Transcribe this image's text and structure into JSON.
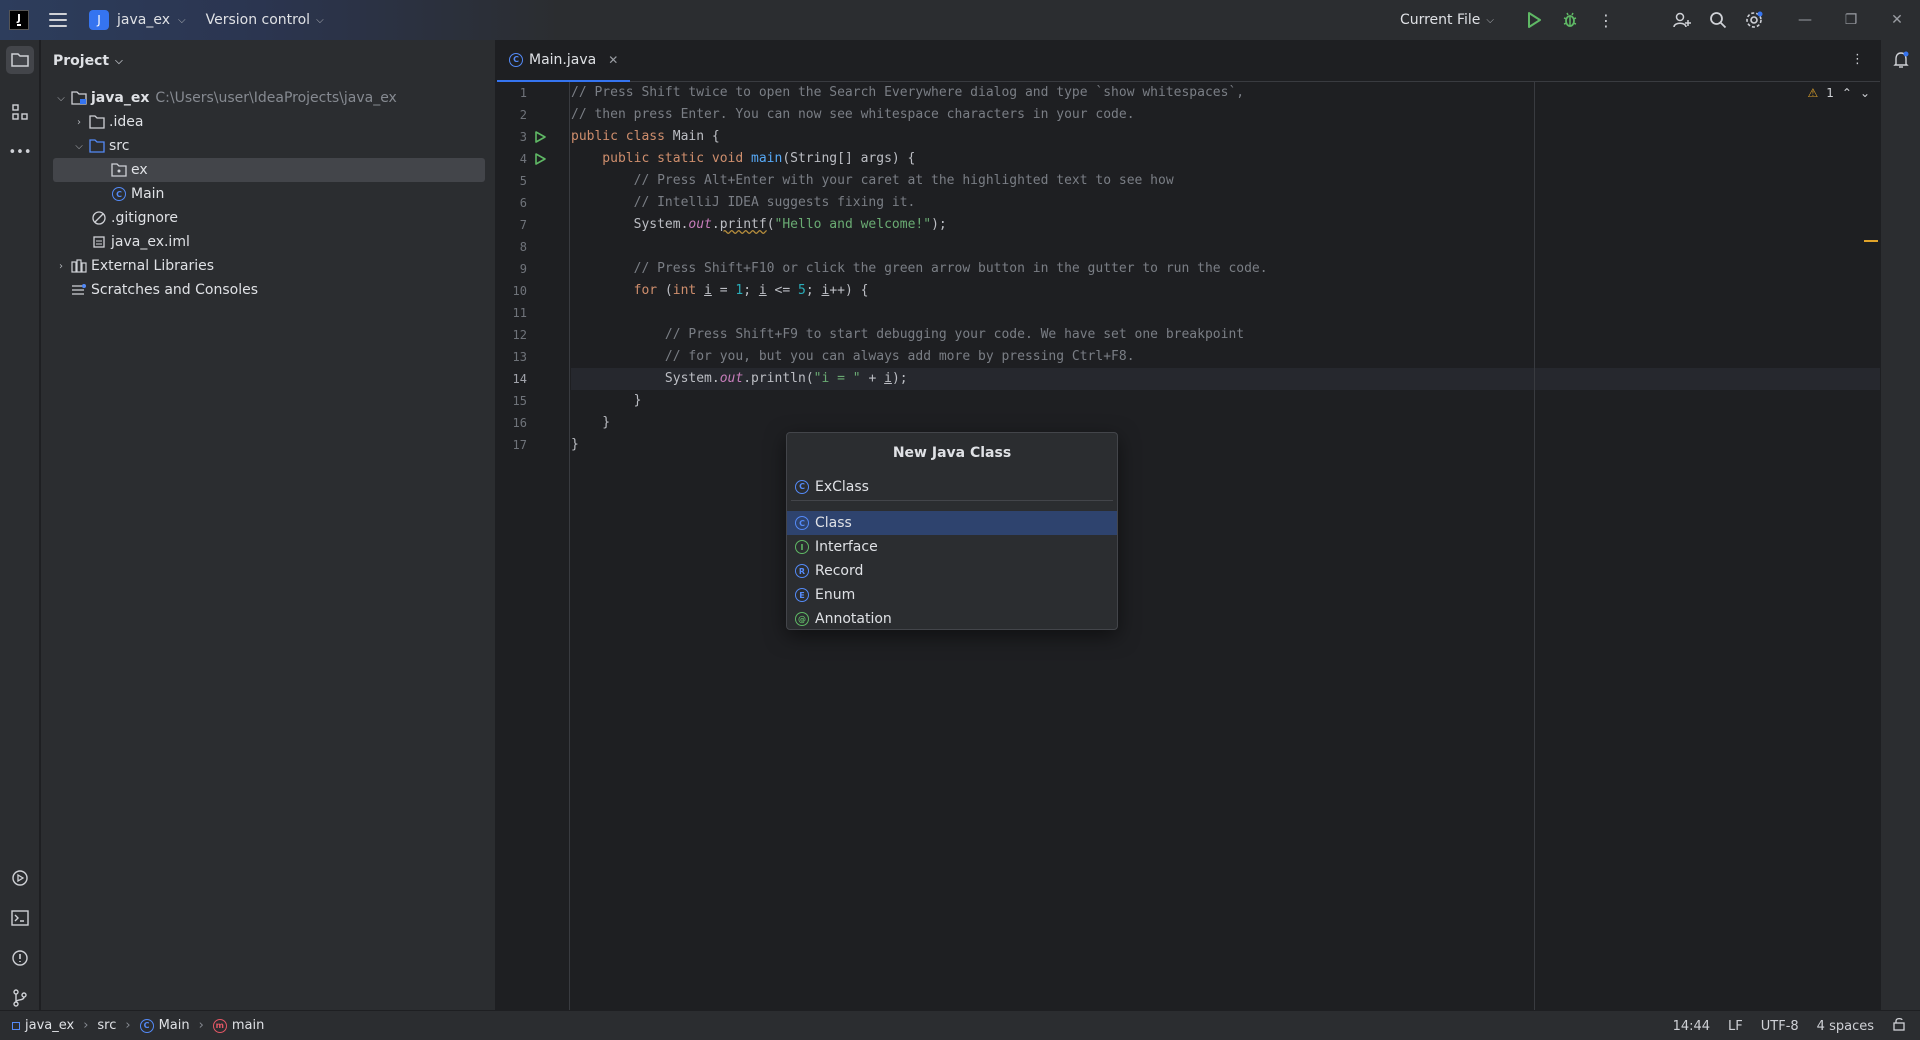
{
  "titlebar": {
    "project_badge": "J",
    "project_name": "java_ex",
    "vcs_label": "Version control",
    "run_config": "Current File"
  },
  "project_panel": {
    "title": "Project",
    "tree": [
      {
        "label": "java_ex",
        "path": "C:\\Users\\user\\IdeaProjects\\java_ex",
        "icon": "module-folder-icon",
        "expanded": true
      },
      {
        "label": ".idea",
        "icon": "folder-icon",
        "expanded": false
      },
      {
        "label": "src",
        "icon": "folder-icon",
        "expanded": true
      },
      {
        "label": "ex",
        "icon": "package-icon",
        "selected": true
      },
      {
        "label": "Main",
        "icon": "class-icon"
      },
      {
        "label": ".gitignore",
        "icon": "ignore-file-icon"
      },
      {
        "label": "java_ex.iml",
        "icon": "iml-file-icon"
      },
      {
        "label": "External Libraries",
        "icon": "libraries-icon",
        "expanded": false
      },
      {
        "label": "Scratches and Consoles",
        "icon": "scratches-icon"
      }
    ]
  },
  "editor": {
    "tab": "Main.java",
    "current_line": 14,
    "line_numbers": [
      "1",
      "2",
      "3",
      "4",
      "5",
      "6",
      "7",
      "8",
      "9",
      "10",
      "11",
      "12",
      "13",
      "14",
      "15",
      "16",
      "17"
    ],
    "warnings_count": "1",
    "lines": {
      "l1": "// Press Shift twice to open the Search Everywhere dialog and type `show whitespaces`,",
      "l2": "// then press Enter. You can now see whitespace characters in your code.",
      "l3a": "public class ",
      "l3b": "Main {",
      "l4a": "    public static void ",
      "l4b": "main",
      "l4c": "(String[] args) {",
      "l5": "        // Press Alt+Enter with your caret at the highlighted text to see how",
      "l6": "        // IntelliJ IDEA suggests fixing it.",
      "l7a": "        System.",
      "l7b": "out",
      "l7c": ".",
      "l7d": "printf",
      "l7e": "(",
      "l7f": "\"Hello and welcome!\"",
      "l7g": ");",
      "l9": "        // Press Shift+F10 or click the green arrow button in the gutter to run the code.",
      "l10a": "        for ",
      "l10b": "(",
      "l10c": "int ",
      "l10d": "i",
      "l10e": " = ",
      "l10f": "1",
      "l10g": "; ",
      "l10h": "i",
      "l10i": " <= ",
      "l10j": "5",
      "l10k": "; ",
      "l10l": "i",
      "l10m": "++) {",
      "l12": "            // Press Shift+F9 to start debugging your code. We have set one breakpoint",
      "l13": "            // for you, but you can always add more by pressing Ctrl+F8.",
      "l14a": "            System.",
      "l14b": "out",
      "l14c": ".println(",
      "l14d": "\"i = \"",
      "l14e": " + ",
      "l14f": "i",
      "l14g": ");",
      "l15": "        }",
      "l16": "    }",
      "l17": "}"
    }
  },
  "dialog": {
    "title": "New Java Class",
    "input_value": "ExClass",
    "options": [
      {
        "label": "Class",
        "letter": "C",
        "selected": true
      },
      {
        "label": "Interface",
        "letter": "I"
      },
      {
        "label": "Record",
        "letter": "R"
      },
      {
        "label": "Enum",
        "letter": "E"
      },
      {
        "label": "Annotation",
        "letter": "@"
      }
    ]
  },
  "statusbar": {
    "breadcrumbs": [
      "java_ex",
      "src",
      "Main",
      "main"
    ],
    "position": "14:44",
    "line_sep": "LF",
    "encoding": "UTF-8",
    "indent": "4 spaces"
  },
  "colors": {
    "accent": "#3574f0",
    "selection": "#2e436e",
    "run_green": "#5fb865",
    "warning": "#e0a32a"
  }
}
